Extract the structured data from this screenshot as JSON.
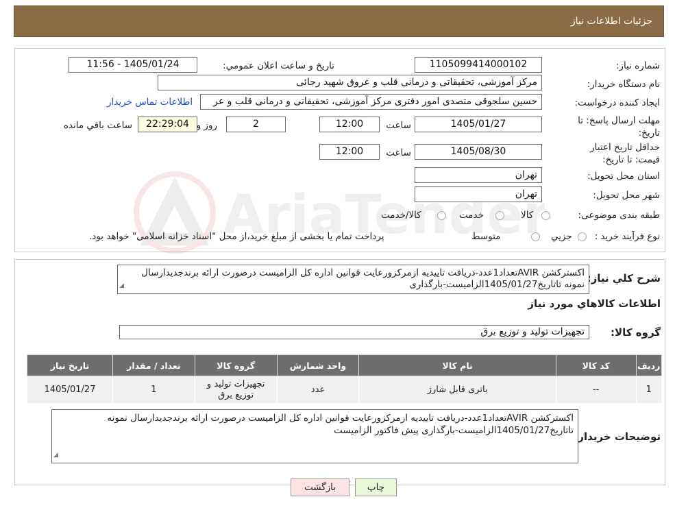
{
  "header": {
    "title": "جزئیات اطلاعات نیاز"
  },
  "form": {
    "need_number_label": "شماره نیاز:",
    "need_number": "1105099414000102",
    "announce_label": "تاریخ و ساعت اعلان عمومي:",
    "announce_value": "1405/01/24 - 11:56",
    "buyer_label": "نام دستگاه خريدار:",
    "buyer_value": "مرکز آموزشی، تحقیقاتی و درمانی قلب و عروق شهید رجائی",
    "creator_label": "ايجاد کننده درخواست:",
    "creator_value": "حسین سلجوقی متصدی امور دفتری مرکز آموزشی، تحقیقاتی و درمانی قلب و عر",
    "contact_link": "اطلاعات تماس خريدار",
    "deadline_label": "مهلت ارسال پاسخ: تا تاریخ:",
    "deadline_date": "1405/01/27",
    "time_label": "ساعت",
    "deadline_time": "12:00",
    "days_value": "2",
    "days_label": "روز و",
    "remaining_time": "22:29:04",
    "remaining_label": "ساعت باقي مانده",
    "validity_label": "حداقل تاریخ اعتبار قیمت: تا تاریخ:",
    "validity_date": "1405/08/30",
    "validity_time": "12:00",
    "province_label": "استان محل تحويل:",
    "province_value": "تهران",
    "city_label": "شهر محل تحويل:",
    "city_value": "تهران",
    "category_label": "طبقه بندی موضوعی:",
    "category_options": [
      "کالا",
      "خدمت",
      "کالا/خدمت"
    ],
    "process_label": "نوع فرآيند خريد :",
    "process_options": [
      "جزيي",
      "متوسط"
    ],
    "process_note": "پرداخت تمام یا بخشی از مبلغ خرید،از محل \"اسناد خزانه اسلامی\" خواهد بود."
  },
  "description": {
    "label": "شرح کلي نياز:",
    "text": "اکسترکشن AVIRتعداد1عدد-دریافت تاییدیه ازمرکزورعایت قوانین اداره کل الزامیست درصورت ارائه برندجدیدارسال نمونه تاتاریخ1405/01/27الزامیست-بارگذاری"
  },
  "goods": {
    "section_title": "اطلاعات کالاهاي مورد نياز",
    "group_label": "گروه کالا:",
    "group_value": "تجهیزات تولید و توزیع برق",
    "columns": [
      "رديف",
      "کد کالا",
      "نام کالا",
      "واحد شمارش",
      "گروه کالا",
      "تعداد / مقدار",
      "تاريخ نياز"
    ],
    "rows": [
      [
        "1",
        "--",
        "باتری قابل شارژ",
        "عدد",
        "تجهیزات تولید و توزیع برق",
        "1",
        "1405/01/27"
      ]
    ]
  },
  "buyer_notes": {
    "label": "توضيحات خريدار:",
    "text": "اکسترکشن AVIRتعداد1عدد-دریافت تاییدیه ازمرکزورعایت قوانین اداره کل الزامیست درصورت ارائه برندجدیدارسال نمونه تاتاریخ1405/01/27الزامیست-بارگذاری پیش فاکتور الزامیست"
  },
  "buttons": {
    "print": "چاپ",
    "back": "بازگشت"
  },
  "watermark": {
    "brand": "AriaTender.neT"
  },
  "colors": {
    "header": "#8a6c47",
    "table_header": "#6e6e6e",
    "link": "#1a4fd0",
    "back_button": "#fde4e4",
    "print_button": "#e8f8d8"
  }
}
